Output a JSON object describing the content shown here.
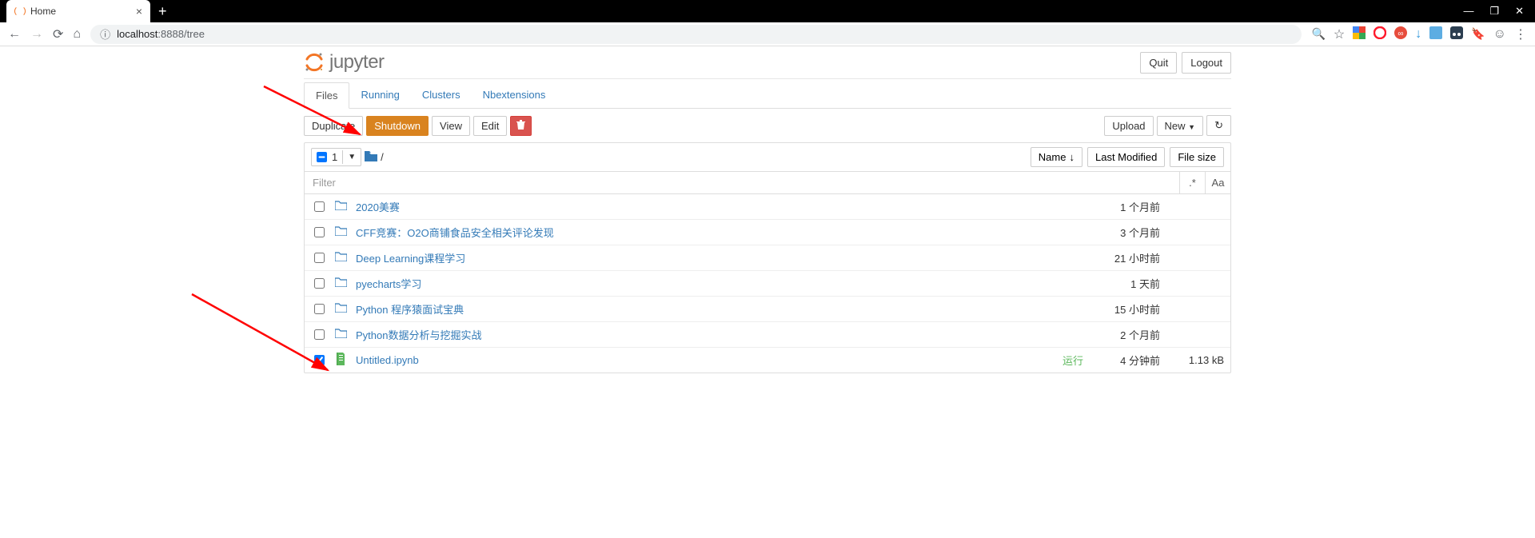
{
  "browser": {
    "tab_title": "Home",
    "url_scheme": "localhost",
    "url_port": ":8888",
    "url_path": "/tree"
  },
  "header": {
    "logo_text": "jupyter",
    "quit_label": "Quit",
    "logout_label": "Logout"
  },
  "tabs": {
    "files": "Files",
    "running": "Running",
    "clusters": "Clusters",
    "nbext": "Nbextensions"
  },
  "actions": {
    "duplicate": "Duplicate",
    "shutdown": "Shutdown",
    "view": "View",
    "edit": "Edit",
    "upload": "Upload",
    "new": "New"
  },
  "crumb": {
    "selected_count": "1",
    "sep": "/",
    "name_col": "Name",
    "lastmod_col": "Last Modified",
    "size_col": "File size"
  },
  "filter": {
    "placeholder": "Filter",
    "regex_btn": ".*",
    "case_btn": "Aa"
  },
  "files": [
    {
      "name": "2020美赛",
      "type": "folder",
      "time": "1 个月前",
      "size": "",
      "checked": false
    },
    {
      "name": "CFF竞赛：O2O商铺食品安全相关评论发现",
      "type": "folder",
      "time": "3 个月前",
      "size": "",
      "checked": false
    },
    {
      "name": "Deep Learning课程学习",
      "type": "folder",
      "time": "21 小时前",
      "size": "",
      "checked": false
    },
    {
      "name": "pyecharts学习",
      "type": "folder",
      "time": "1 天前",
      "size": "",
      "checked": false
    },
    {
      "name": "Python 程序猿面试宝典",
      "type": "folder",
      "time": "15 小时前",
      "size": "",
      "checked": false
    },
    {
      "name": "Python数据分析与挖掘实战",
      "type": "folder",
      "time": "2 个月前",
      "size": "",
      "checked": false
    },
    {
      "name": "Untitled.ipynb",
      "type": "notebook",
      "time": "4 分钟前",
      "size": "1.13 kB",
      "status": "运行",
      "checked": true
    }
  ]
}
